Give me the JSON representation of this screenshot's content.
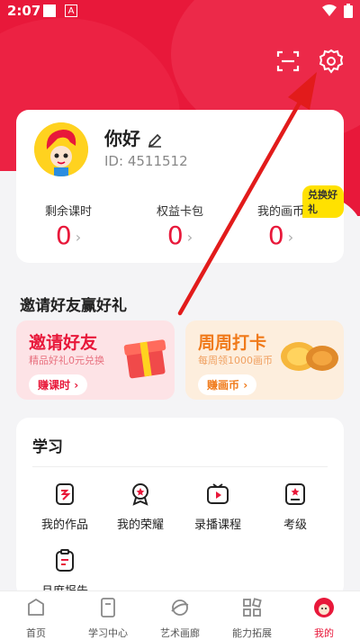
{
  "status": {
    "time": "2:07"
  },
  "profile": {
    "greeting": "你好",
    "id_label": "ID:",
    "id_value": "4511512"
  },
  "stats": [
    {
      "label": "剩余课时",
      "value": "0"
    },
    {
      "label": "权益卡包",
      "value": "0"
    },
    {
      "label": "我的画币",
      "value": "0"
    }
  ],
  "badge": "兑换好礼",
  "invite": {
    "section_title": "邀请好友赢好礼"
  },
  "promos": [
    {
      "title": "邀请好友",
      "subtitle": "精品好礼0元兑换",
      "button": "赚课时"
    },
    {
      "title": "周周打卡",
      "subtitle": "每周领1000画币",
      "button": "赚画币"
    }
  ],
  "learning": {
    "title": "学习",
    "items": [
      {
        "label": "我的作品",
        "icon": "works-icon"
      },
      {
        "label": "我的荣耀",
        "icon": "medal-icon"
      },
      {
        "label": "录播课程",
        "icon": "video-icon"
      },
      {
        "label": "考级",
        "icon": "exam-icon"
      },
      {
        "label": "月度报告",
        "icon": "report-icon"
      }
    ]
  },
  "tabs": [
    {
      "label": "首页",
      "icon": "home-icon"
    },
    {
      "label": "学习中心",
      "icon": "study-icon"
    },
    {
      "label": "艺术画廊",
      "icon": "gallery-icon"
    },
    {
      "label": "能力拓展",
      "icon": "grid-icon"
    },
    {
      "label": "我的",
      "icon": "mascot-icon",
      "active": true
    }
  ],
  "colors": {
    "primary": "#e8183a",
    "promo1_bg": "#fde3e6",
    "promo2_bg": "#fdeedd",
    "badge": "#ffe100"
  }
}
